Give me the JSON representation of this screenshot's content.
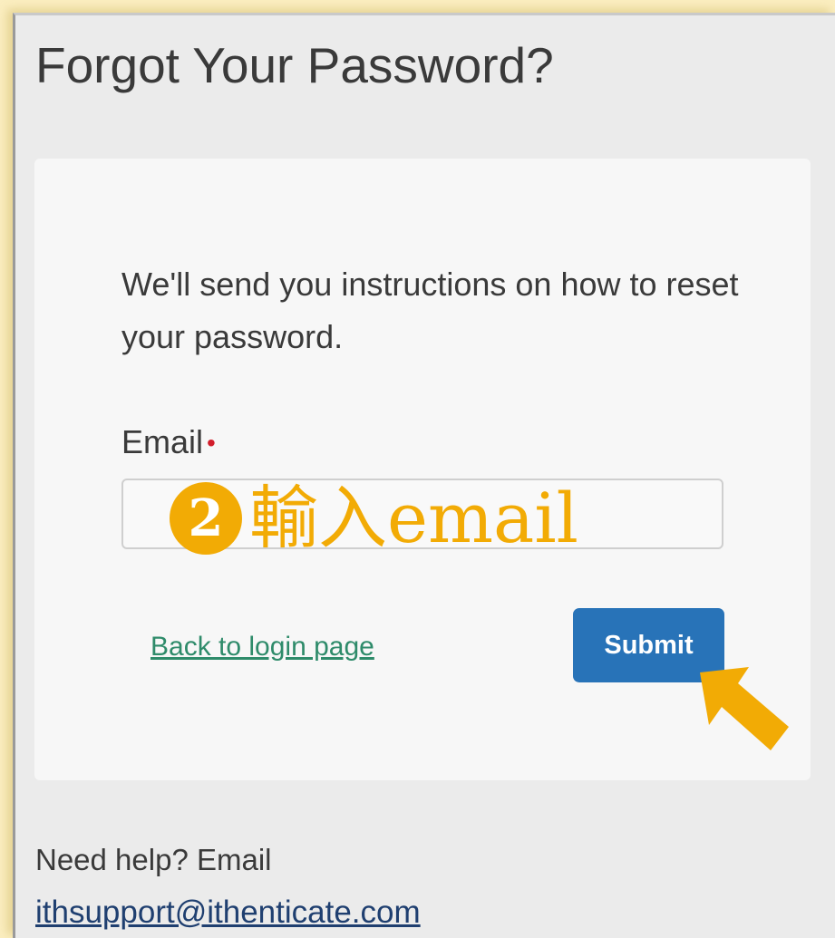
{
  "page": {
    "title": "Forgot Your Password?"
  },
  "form": {
    "instructions": "We'll send you instructions on how to reset your password.",
    "email_label": "Email",
    "required_mark": "•",
    "email_value": "",
    "back_link": "Back to login page",
    "submit_label": "Submit"
  },
  "help": {
    "text": "Need help? Email",
    "support_email": "ithsupport@ithenticate.com"
  },
  "annotation": {
    "step_number": "2",
    "step_text": "輸入email",
    "arrow_icon": "arrow-up-left-icon"
  },
  "colors": {
    "accent": "#f2ab05",
    "submit_button": "#2873b8",
    "back_link": "#2e8b6a",
    "required": "#d21e2b"
  }
}
